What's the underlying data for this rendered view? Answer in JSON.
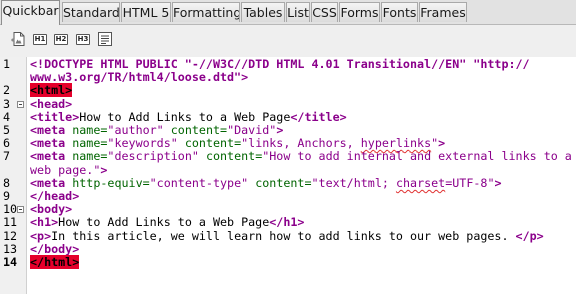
{
  "tabs": [
    {
      "label": "Quickbar",
      "active": true
    },
    {
      "label": "Standard",
      "active": false
    },
    {
      "label": "HTML 5",
      "active": false
    },
    {
      "label": "Formatting",
      "active": false
    },
    {
      "label": "Tables",
      "active": false
    },
    {
      "label": "List",
      "active": false
    },
    {
      "label": "CSS",
      "active": false
    },
    {
      "label": "Forms",
      "active": false
    },
    {
      "label": "Fonts",
      "active": false
    },
    {
      "label": "Frames",
      "active": false
    }
  ],
  "toolbar": {
    "h1_label": "H1",
    "h2_label": "H2",
    "h3_label": "H3"
  },
  "colors": {
    "tag": "#8b008b",
    "attribute": "#006400",
    "value": "#8b008b",
    "highlight": "#e5002b"
  },
  "editor": {
    "line_numbers": [
      "1",
      "",
      "2",
      "3",
      "4",
      "5",
      "6",
      "7",
      "",
      "8",
      "9",
      "10",
      "11",
      "12",
      "13",
      "14"
    ],
    "rows": [
      [
        [
          "tag",
          "<!DOCTYPE HTML PUBLIC \"-//W3C//DTD HTML 4.01 Transitional//EN\" \"http://"
        ]
      ],
      [
        [
          "tag",
          "www.w3.org/TR/html4/loose.dtd\">"
        ]
      ],
      [
        [
          "hl",
          "<html>"
        ]
      ],
      [
        [
          "tag",
          "<head>"
        ]
      ],
      [
        [
          "tag",
          "<title>"
        ],
        [
          "txt",
          "How to Add Links to a Web Page"
        ],
        [
          "tag",
          "</title>"
        ]
      ],
      [
        [
          "tag",
          "<meta "
        ],
        [
          "attr",
          "name="
        ],
        [
          "val",
          "\"author\" "
        ],
        [
          "attr",
          "content="
        ],
        [
          "val",
          "\"David\""
        ],
        [
          "tag",
          ">"
        ]
      ],
      [
        [
          "tag",
          "<meta "
        ],
        [
          "attr",
          "name="
        ],
        [
          "val",
          "\"keywords\" "
        ],
        [
          "attr",
          "content="
        ],
        [
          "val",
          "\"links, Anchors, "
        ],
        [
          "valsq",
          "hyperlinks"
        ],
        [
          "val",
          "\""
        ],
        [
          "tag",
          ">"
        ]
      ],
      [
        [
          "tag",
          "<meta "
        ],
        [
          "attr",
          "name="
        ],
        [
          "val",
          "\"description\" "
        ],
        [
          "attr",
          "content="
        ],
        [
          "val",
          "\"How to add internal and external links to a"
        ]
      ],
      [
        [
          "val",
          "web page.\""
        ],
        [
          "tag",
          ">"
        ]
      ],
      [
        [
          "tag",
          "<meta "
        ],
        [
          "attr",
          "http-equiv="
        ],
        [
          "val",
          "\"content-type\" "
        ],
        [
          "attr",
          "content="
        ],
        [
          "val",
          "\"text/html; "
        ],
        [
          "valsq",
          "charset"
        ],
        [
          "val",
          "=UTF-8\""
        ],
        [
          "tag",
          ">"
        ]
      ],
      [
        [
          "tag",
          "</head>"
        ]
      ],
      [
        [
          "tag",
          "<body>"
        ]
      ],
      [
        [
          "tag",
          "<h1>"
        ],
        [
          "txt",
          "How to Add Links to a Web Page"
        ],
        [
          "tag",
          "</h1>"
        ]
      ],
      [
        [
          "tag",
          "<p>"
        ],
        [
          "txt",
          "In this article, we will learn how to add links to our web pages. "
        ],
        [
          "tag",
          "</p>"
        ]
      ],
      [
        [
          "tag",
          "</body>"
        ]
      ],
      [
        [
          "hl",
          "</html>"
        ]
      ]
    ]
  }
}
